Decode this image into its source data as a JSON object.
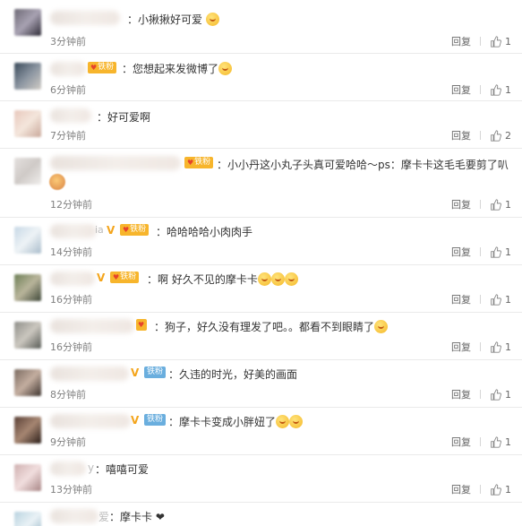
{
  "comments": [
    {
      "text": "：小揪揪好可爱",
      "emoji": "kiss-emoji",
      "badges": [],
      "time": "3分钟前",
      "likes": "1"
    },
    {
      "text": "：您想起来发微博了",
      "emoji": "sad-emoji",
      "badges": [
        "fan"
      ],
      "fan_label": "铁粉",
      "time": "6分钟前",
      "likes": "1"
    },
    {
      "text": "：好可爱啊",
      "emoji": "",
      "badges": [],
      "time": "7分钟前",
      "likes": "2"
    },
    {
      "text": "：小小丹这小丸子头真可爱哈哈～ps：摩卡卡这毛毛要剪了叭",
      "emoji": "dog-sticker",
      "badges": [
        "fan"
      ],
      "fan_label": "铁粉",
      "time": "12分钟前",
      "likes": "1"
    },
    {
      "text": "：哈哈哈哈小肉肉手",
      "emoji": "",
      "badges": [
        "vip",
        "fan"
      ],
      "name_fragment": "ia",
      "fan_label": "铁粉",
      "time": "14分钟前",
      "likes": "1"
    },
    {
      "text": "：啊 好久不见的摩卡卡",
      "emoji": "sad-emoji-x3",
      "badges": [
        "vip",
        "fan"
      ],
      "fan_label": "铁粉",
      "time": "16分钟前",
      "likes": "1"
    },
    {
      "text": "：狗子，好久没有理发了吧。。都看不到眼睛了",
      "emoji": "smile-emoji",
      "badges": [
        "fan-mini"
      ],
      "time": "16分钟前",
      "likes": "1"
    },
    {
      "text": "：久违的时光，好美的画面",
      "emoji": "",
      "badges": [
        "vip",
        "fan-blue"
      ],
      "fan_label": "铁粉",
      "time": "8分钟前",
      "likes": "1"
    },
    {
      "text": "：摩卡卡变成小胖妞了",
      "emoji": "laugh-emoji-x2",
      "badges": [
        "vip",
        "fan-blue"
      ],
      "fan_label": "铁粉",
      "time": "9分钟前",
      "likes": "1"
    },
    {
      "text": "：嘻嘻可爱",
      "emoji": "",
      "badges": [],
      "name_fragment": "y",
      "time": "13分钟前",
      "likes": "1"
    },
    {
      "text": "：摩卡卡 ❤",
      "emoji": "",
      "badges": [],
      "name_fragment": "爱",
      "time": "",
      "likes": ""
    }
  ],
  "labels": {
    "reply": "回复"
  },
  "icons": {
    "like": "thumbs-up-icon"
  }
}
